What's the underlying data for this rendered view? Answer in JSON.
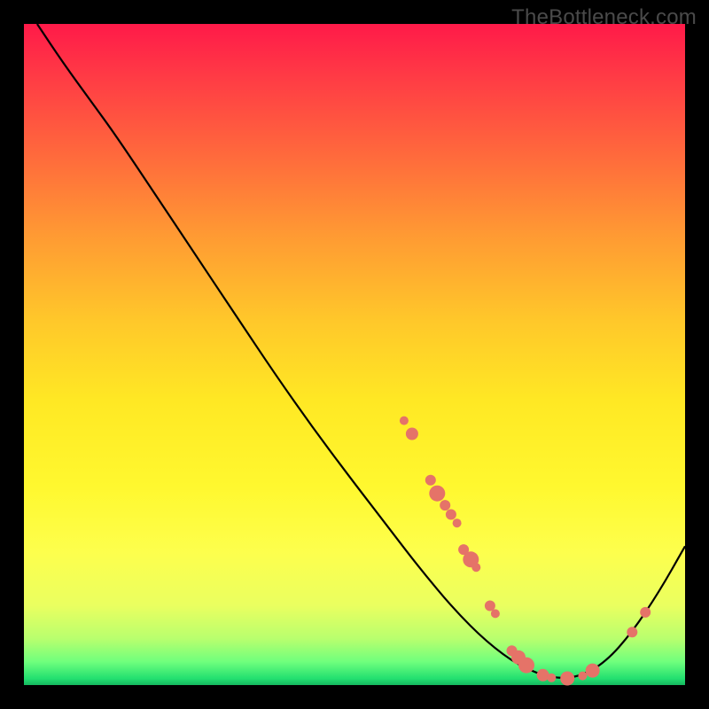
{
  "watermark": "TheBottleneck.com",
  "colors": {
    "dot": "#e57368",
    "curve": "#000000",
    "frame_bg_top": "#ff1a49",
    "frame_bg_bottom": "#16b85f",
    "page_bg": "#000000"
  },
  "chart_data": {
    "type": "line",
    "title": "",
    "xlabel": "",
    "ylabel": "",
    "xlim": [
      0,
      100
    ],
    "ylim": [
      0,
      100
    ],
    "grid": false,
    "legend": false,
    "curve": [
      {
        "x": 2.0,
        "y": 100.0
      },
      {
        "x": 6.0,
        "y": 94.0
      },
      {
        "x": 10.0,
        "y": 88.5
      },
      {
        "x": 14.0,
        "y": 83.0
      },
      {
        "x": 20.0,
        "y": 74.0
      },
      {
        "x": 26.0,
        "y": 65.0
      },
      {
        "x": 32.0,
        "y": 56.0
      },
      {
        "x": 38.0,
        "y": 47.0
      },
      {
        "x": 44.0,
        "y": 38.5
      },
      {
        "x": 50.0,
        "y": 30.5
      },
      {
        "x": 55.0,
        "y": 24.0
      },
      {
        "x": 60.0,
        "y": 17.5
      },
      {
        "x": 65.0,
        "y": 11.5
      },
      {
        "x": 70.0,
        "y": 6.5
      },
      {
        "x": 75.0,
        "y": 2.8
      },
      {
        "x": 80.0,
        "y": 1.0
      },
      {
        "x": 84.0,
        "y": 1.2
      },
      {
        "x": 88.0,
        "y": 3.5
      },
      {
        "x": 92.0,
        "y": 8.0
      },
      {
        "x": 96.0,
        "y": 14.0
      },
      {
        "x": 100.0,
        "y": 21.0
      }
    ],
    "dots": [
      {
        "x": 57.5,
        "y": 40.0,
        "r": 5
      },
      {
        "x": 58.7,
        "y": 38.0,
        "r": 7
      },
      {
        "x": 61.5,
        "y": 31.0,
        "r": 6
      },
      {
        "x": 62.5,
        "y": 29.0,
        "r": 9
      },
      {
        "x": 63.7,
        "y": 27.2,
        "r": 6
      },
      {
        "x": 64.6,
        "y": 25.8,
        "r": 6
      },
      {
        "x": 65.5,
        "y": 24.5,
        "r": 5
      },
      {
        "x": 66.5,
        "y": 20.5,
        "r": 6
      },
      {
        "x": 67.6,
        "y": 19.0,
        "r": 9
      },
      {
        "x": 68.4,
        "y": 17.8,
        "r": 5
      },
      {
        "x": 70.5,
        "y": 12.0,
        "r": 6
      },
      {
        "x": 71.3,
        "y": 10.8,
        "r": 5
      },
      {
        "x": 73.8,
        "y": 5.2,
        "r": 6
      },
      {
        "x": 74.8,
        "y": 4.2,
        "r": 8
      },
      {
        "x": 76.0,
        "y": 3.0,
        "r": 9
      },
      {
        "x": 78.5,
        "y": 1.5,
        "r": 7
      },
      {
        "x": 79.8,
        "y": 1.1,
        "r": 5
      },
      {
        "x": 82.2,
        "y": 1.0,
        "r": 8
      },
      {
        "x": 84.5,
        "y": 1.4,
        "r": 5
      },
      {
        "x": 86.0,
        "y": 2.2,
        "r": 8
      },
      {
        "x": 92.0,
        "y": 8.0,
        "r": 6
      },
      {
        "x": 94.0,
        "y": 11.0,
        "r": 6
      }
    ]
  }
}
